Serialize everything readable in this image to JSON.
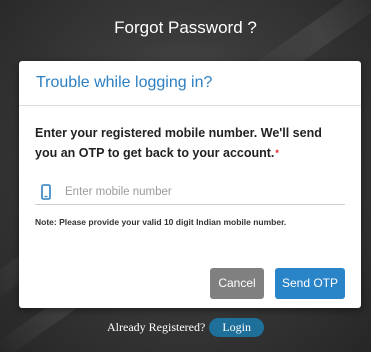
{
  "screen": {
    "title": "Forgot Password ?"
  },
  "modal": {
    "title": "Trouble while logging in?",
    "prompt": "Enter your registered mobile number. We'll send you an OTP to get back to your account.",
    "required_marker": "*",
    "mobile_input": {
      "placeholder": "Enter mobile number",
      "value": "",
      "icon": "mobile-phone-icon"
    },
    "note": "Note: Please provide your valid 10 digit Indian mobile number.",
    "buttons": {
      "cancel": "Cancel",
      "send_otp": "Send OTP"
    }
  },
  "footer": {
    "text": "Already Registered?",
    "login_label": "Login"
  },
  "colors": {
    "title_blue": "#2c7fc1",
    "send_button": "#2a84c8",
    "cancel_button": "#808080",
    "login_pill": "#1e6f99",
    "required": "#e02020"
  }
}
